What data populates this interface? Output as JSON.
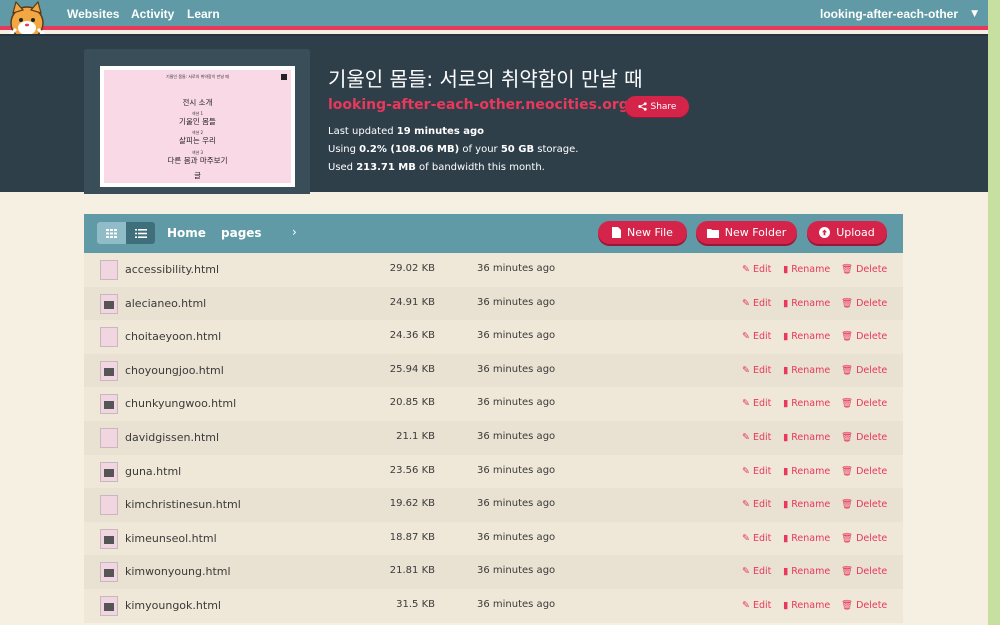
{
  "nav": {
    "links": [
      "Websites",
      "Activity",
      "Learn"
    ],
    "user": "looking-after-each-other"
  },
  "site": {
    "title": "기울인 몸들: 서로의 취약함이 만날 때",
    "url": "looking-after-each-other.neocities.org",
    "share_label": "Share",
    "updated_prefix": "Last updated ",
    "updated_value": "19 minutes ago",
    "storage_prefix": "Using ",
    "storage_value": "0.2% (108.06 MB)",
    "storage_mid": " of your ",
    "storage_total": "50 GB",
    "storage_suffix": " storage.",
    "bandwidth_prefix": "Used ",
    "bandwidth_value": "213.71 MB",
    "bandwidth_suffix": " of bandwidth this month."
  },
  "thumbnail": {
    "top_text": "기울인 몸들: 서로의 취약함이 만날 때",
    "lines": [
      "전시 소개",
      "기울인 몸들",
      "살피는 우리",
      "다른 몸과 마주보기",
      "글"
    ],
    "small": [
      "섹션 1",
      "섹션 2",
      "섹션 3"
    ]
  },
  "file_manager": {
    "breadcrumb_home": "Home",
    "breadcrumb_current": "pages",
    "new_file_label": "New File",
    "new_folder_label": "New Folder",
    "upload_label": "Upload",
    "edit_label": "Edit",
    "rename_label": "Rename",
    "delete_label": "Delete",
    "files": [
      {
        "name": "accessibility.html",
        "size": "29.02 KB",
        "modified": "36 minutes ago"
      },
      {
        "name": "alecianeo.html",
        "size": "24.91 KB",
        "modified": "36 minutes ago"
      },
      {
        "name": "choitaeyoon.html",
        "size": "24.36 KB",
        "modified": "36 minutes ago"
      },
      {
        "name": "choyoungjoo.html",
        "size": "25.94 KB",
        "modified": "36 minutes ago"
      },
      {
        "name": "chunkyungwoo.html",
        "size": "20.85 KB",
        "modified": "36 minutes ago"
      },
      {
        "name": "davidgissen.html",
        "size": "21.1 KB",
        "modified": "36 minutes ago"
      },
      {
        "name": "guna.html",
        "size": "23.56 KB",
        "modified": "36 minutes ago"
      },
      {
        "name": "kimchristinesun.html",
        "size": "19.62 KB",
        "modified": "36 minutes ago"
      },
      {
        "name": "kimeunseol.html",
        "size": "18.87 KB",
        "modified": "36 minutes ago"
      },
      {
        "name": "kimwonyoung.html",
        "size": "21.81 KB",
        "modified": "36 minutes ago"
      },
      {
        "name": "kimyoungok.html",
        "size": "31.5 KB",
        "modified": "36 minutes ago"
      }
    ]
  },
  "colors": {
    "nav": "#5f9aa6",
    "accent": "#e8385b",
    "button": "#d5244a",
    "header": "#2f3f4a",
    "page_bg": "#f6f0e2"
  }
}
